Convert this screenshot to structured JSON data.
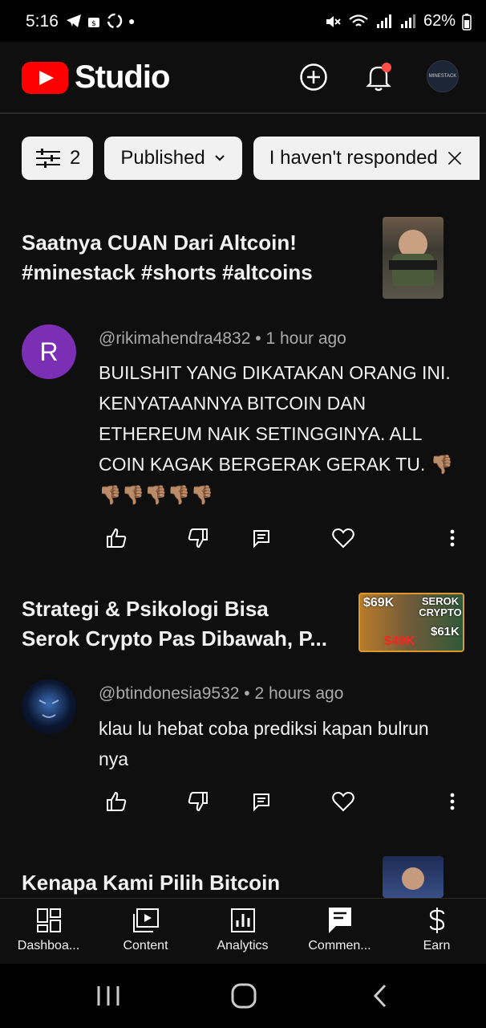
{
  "status": {
    "time": "5:16",
    "battery": "62%"
  },
  "header": {
    "brand": "Studio",
    "avatar_text": "MINESTACK"
  },
  "filters": {
    "count": "2",
    "published": "Published",
    "responded": "I haven't responded"
  },
  "items": [
    {
      "video_title_1": "Saatnya CUAN Dari Altcoin!",
      "video_title_2": "#minestack #shorts #altcoins",
      "avatar_letter": "R",
      "avatar_color": "#7b2fb5",
      "meta": "@rikimahendra4832 • 1 hour ago",
      "text": "BUILSHIT YANG DIKATAKAN ORANG INI. KENYATAANNYA BITCOIN DAN ETHEREUM NAIK SETINGGINYA. ALL COIN KAGAK BERGERAK GERAK TU. 👎🏽👎🏽👎🏽👎🏽👎🏽👎🏽"
    },
    {
      "video_title_1": "Strategi & Psikologi Bisa",
      "video_title_2": "Serok Crypto Pas Dibawah, P...",
      "meta": "@btindonesia9532 • 2 hours ago",
      "text": "klau lu  hebat coba prediksi kapan bulrun nya",
      "thumb_labels": [
        "$69K",
        "SEROK CRYPTO",
        "$61K",
        "$49K"
      ]
    },
    {
      "video_title_1": "Kenapa Kami Pilih Bitcoin"
    }
  ],
  "nav": [
    {
      "label": "Dashboa...",
      "icon": "dashboard-icon"
    },
    {
      "label": "Content",
      "icon": "content-icon"
    },
    {
      "label": "Analytics",
      "icon": "analytics-icon"
    },
    {
      "label": "Commen...",
      "icon": "comments-icon"
    },
    {
      "label": "Earn",
      "icon": "earn-icon"
    }
  ],
  "colors": {
    "accent": "#ff0000",
    "notification_dot": "#ff4e45"
  }
}
